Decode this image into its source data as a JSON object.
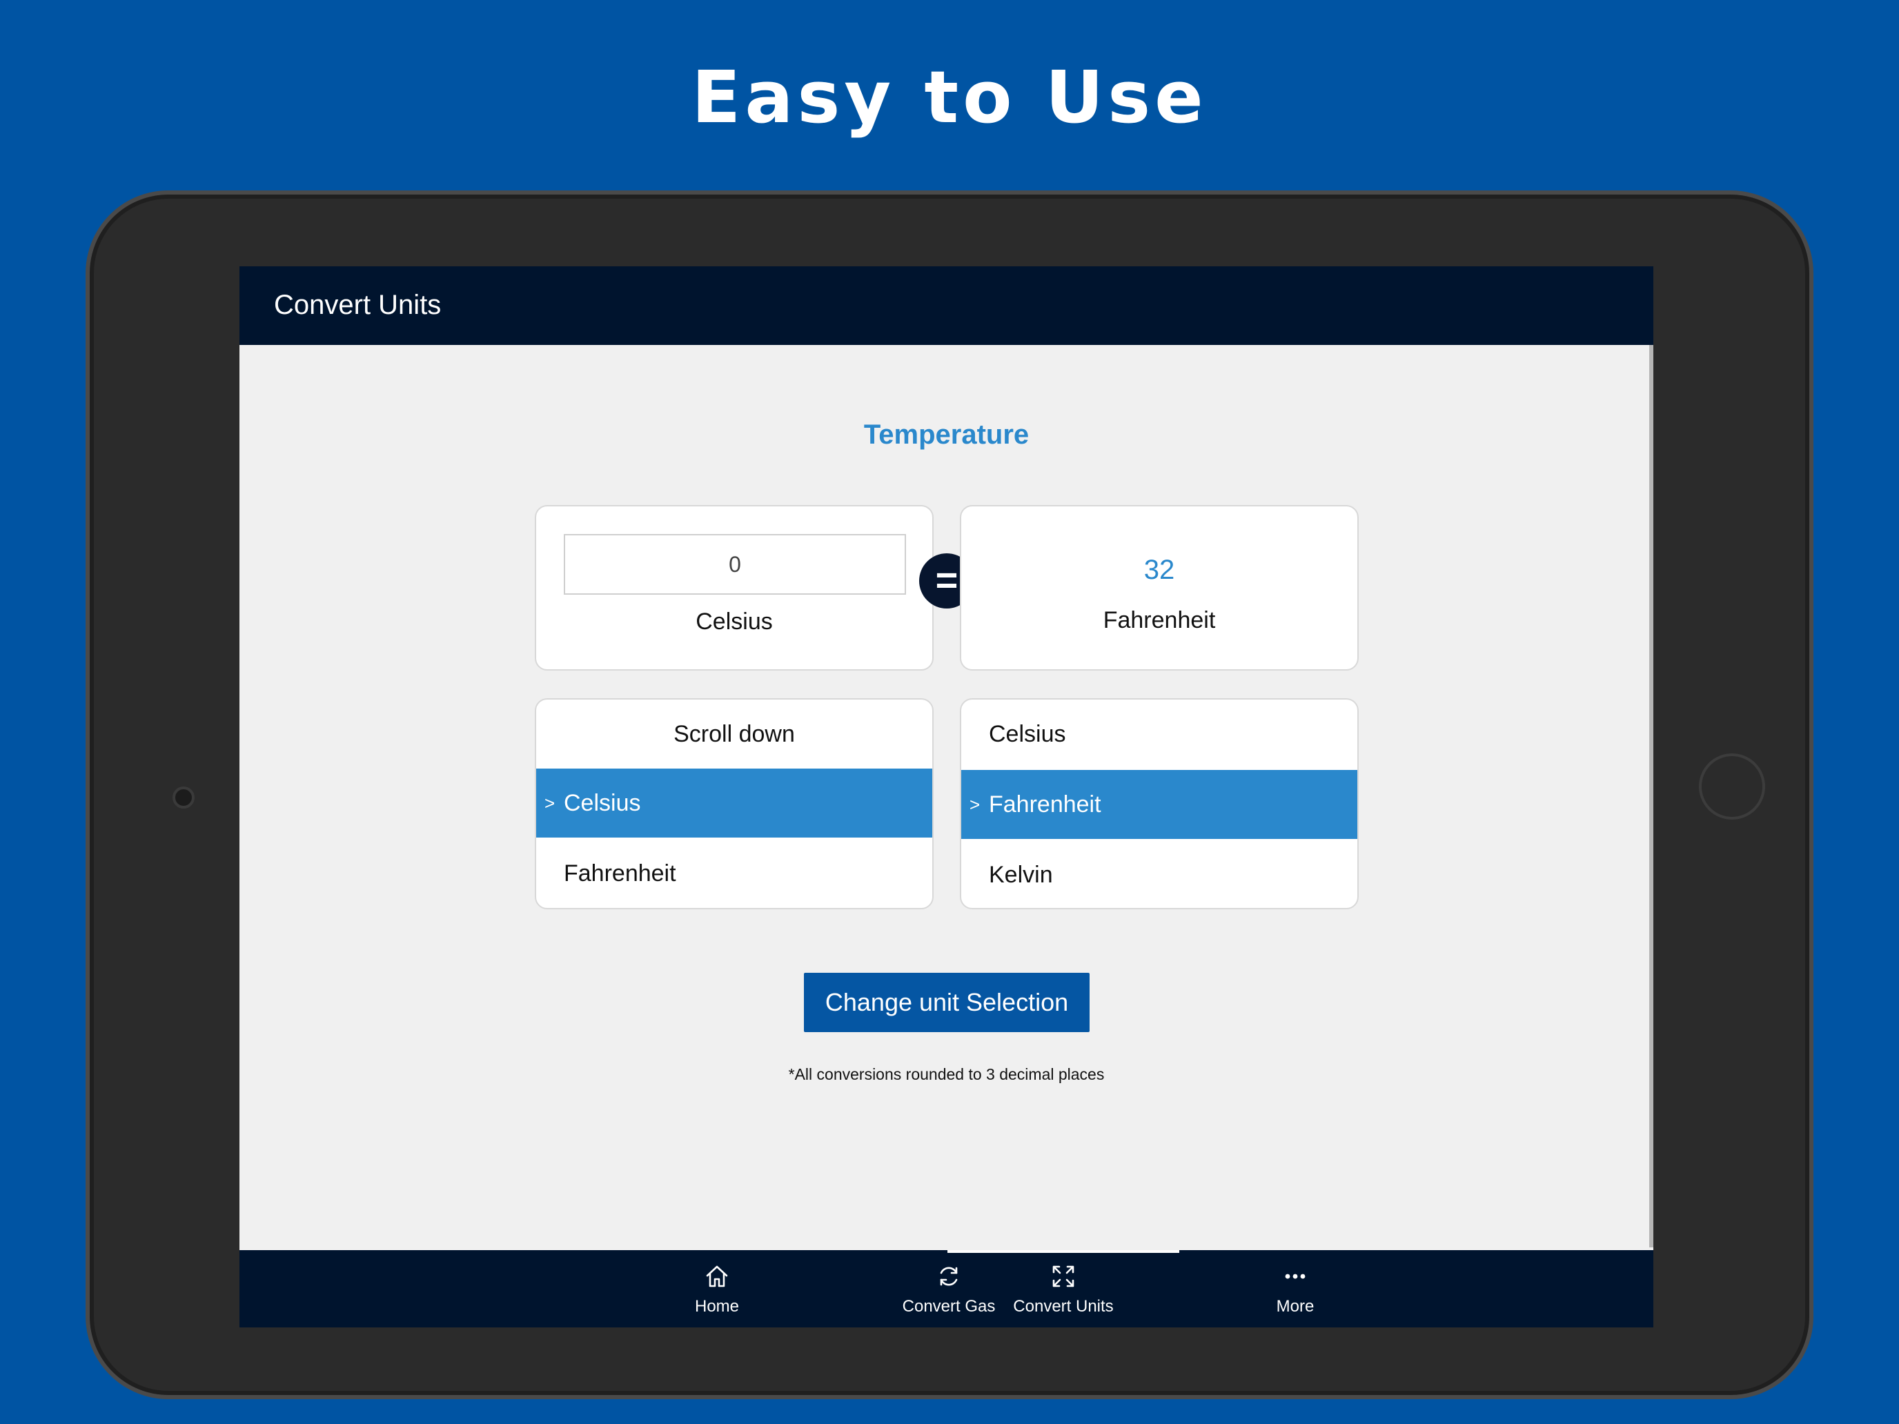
{
  "headline": "Easy to Use",
  "app": {
    "title": "Convert Units"
  },
  "converter": {
    "category": "Temperature",
    "input": {
      "value": "0",
      "unit": "Celsius"
    },
    "equals_symbol": "=",
    "output": {
      "value": "32",
      "unit": "Fahrenheit"
    },
    "from_picker": {
      "items": [
        {
          "label": "Scroll down",
          "selected": false
        },
        {
          "label": "Celsius",
          "selected": true
        },
        {
          "label": "Fahrenheit",
          "selected": false
        }
      ]
    },
    "to_picker": {
      "items": [
        {
          "label": "Celsius",
          "selected": false
        },
        {
          "label": "Fahrenheit",
          "selected": true
        },
        {
          "label": "Kelvin",
          "selected": false
        }
      ]
    },
    "selected_marker": ">",
    "change_button": "Change unit Selection",
    "footnote": "*All conversions rounded to 3 decimal places"
  },
  "tabbar": {
    "tabs": [
      {
        "label": "Home",
        "icon": "home-icon",
        "active": false
      },
      {
        "label": "Convert Gas",
        "icon": "refresh-icon",
        "active": false
      },
      {
        "label": "Convert Units",
        "icon": "expand-arrows-icon",
        "active": true
      },
      {
        "label": "More",
        "icon": "more-dots-icon",
        "active": false
      }
    ]
  },
  "colors": {
    "background": "#0054a3",
    "header": "#00142e",
    "accent": "#2a88cc",
    "button": "#0556a3"
  }
}
